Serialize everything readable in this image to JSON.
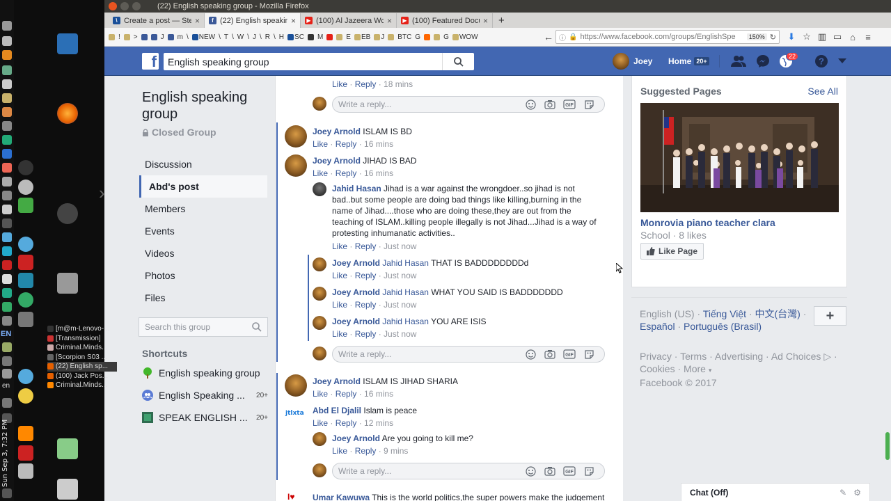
{
  "os": {
    "clock": "Sun Sep 3, 7:32 PM",
    "lang": "EN",
    "lang2": "en",
    "taskbar": [
      {
        "label": "[m@m-Lenovo-...",
        "color": "#333"
      },
      {
        "label": "[Transmission]",
        "color": "#c33"
      },
      {
        "label": "Criminal.Minds...",
        "color": "#caa"
      },
      {
        "label": "[Scorpion S03 ...",
        "color": "#666"
      },
      {
        "label": "(22) English sp...",
        "color": "#e66000"
      },
      {
        "label": "(100) Jack Pos...",
        "color": "#e66000"
      },
      {
        "label": "Criminal.Minds...",
        "color": "#f80"
      }
    ]
  },
  "browser": {
    "window_title": "(22) English speaking group - Mozilla Firefox",
    "tabs": [
      {
        "label": "Create a post — Steem",
        "icon": "steem-icon",
        "color": "#1a5099",
        "glyph": "\\"
      },
      {
        "label": "(22) English speaking",
        "icon": "facebook-icon",
        "color": "#3b5998",
        "glyph": "f",
        "active": true
      },
      {
        "label": "(100) Al Jazeera World",
        "icon": "youtube-icon",
        "color": "#e62117",
        "glyph": "▶"
      },
      {
        "label": "(100) Featured Docum",
        "icon": "youtube-icon",
        "color": "#e62117",
        "glyph": "▶"
      }
    ],
    "bookmarks": [
      {
        "label": "",
        "color": "#c9b26b"
      },
      {
        "label": "!",
        "color": ""
      },
      {
        "label": "",
        "color": "#c9b26b"
      },
      {
        "label": ">",
        "color": ""
      },
      {
        "label": "",
        "color": "#3b5998"
      },
      {
        "label": "",
        "color": "#3b5998"
      },
      {
        "label": "J",
        "color": ""
      },
      {
        "label": "",
        "color": "#3b5998"
      },
      {
        "label": "m",
        "color": ""
      },
      {
        "label": "\\",
        "color": ""
      },
      {
        "label": "NEW",
        "color": "#1a5099"
      },
      {
        "label": "\\",
        "color": ""
      },
      {
        "label": "T",
        "color": ""
      },
      {
        "label": "\\",
        "color": ""
      },
      {
        "label": "W",
        "color": ""
      },
      {
        "label": "\\",
        "color": ""
      },
      {
        "label": "J",
        "color": ""
      },
      {
        "label": "\\",
        "color": ""
      },
      {
        "label": "R",
        "color": ""
      },
      {
        "label": "\\",
        "color": ""
      },
      {
        "label": "H",
        "color": ""
      },
      {
        "label": "SC",
        "color": "#1a5099"
      },
      {
        "label": "",
        "color": "#333"
      },
      {
        "label": "M",
        "color": ""
      },
      {
        "label": "",
        "color": "#e62117"
      },
      {
        "label": "",
        "color": "#c9b26b"
      },
      {
        "label": "E",
        "color": ""
      },
      {
        "label": "EB",
        "color": "#c9b26b"
      },
      {
        "label": "J",
        "color": "#c9b26b"
      },
      {
        "label": "",
        "color": "#c9b26b"
      },
      {
        "label": "BTC",
        "color": ""
      },
      {
        "label": "G",
        "color": ""
      },
      {
        "label": "",
        "color": "#f60"
      },
      {
        "label": "",
        "color": "#c9b26b"
      },
      {
        "label": "G",
        "color": ""
      },
      {
        "label": "WOW",
        "color": "#c9b26b"
      }
    ],
    "url": "https://www.facebook.com/groups/EnglishSpe",
    "zoom": "150%"
  },
  "facebook": {
    "search_value": "English speaking group",
    "profile_name": "Joey",
    "home_label": "Home",
    "home_badge": "20+",
    "notif_count": "22"
  },
  "group": {
    "title": "English speaking group",
    "privacy": "Closed Group",
    "nav": [
      {
        "label": "Discussion",
        "active": false
      },
      {
        "label": "Abd's post",
        "active": true
      },
      {
        "label": "Members",
        "active": false
      },
      {
        "label": "Events",
        "active": false
      },
      {
        "label": "Videos",
        "active": false
      },
      {
        "label": "Photos",
        "active": false
      },
      {
        "label": "Files",
        "active": false
      }
    ],
    "search_placeholder": "Search this group",
    "shortcuts_title": "Shortcuts",
    "shortcuts": [
      {
        "label": "English speaking group",
        "badge": "",
        "icon": "tree-icon"
      },
      {
        "label": "English Speaking ...",
        "badge": "20+",
        "icon": "group-icon"
      },
      {
        "label": "SPEAK ENGLISH ...",
        "badge": "20+",
        "icon": "page-icon"
      }
    ]
  },
  "feed": {
    "top_actions": {
      "like": "Like",
      "reply": "Reply",
      "time": "18 mins"
    },
    "reply_placeholder": "Write a reply...",
    "comments": [
      {
        "id": "c1",
        "author": "Joey Arnold",
        "text": "ISLAM IS BD",
        "time": "16 mins"
      },
      {
        "id": "c2",
        "author": "Joey Arnold",
        "text": "JIHAD IS BAD",
        "time": "16 mins"
      },
      {
        "id": "c3",
        "author": "Jahid Hasan",
        "lines": [
          "Jihad is a war against the wrongdoer..so jihad is not",
          "bad..but some people are doing bad things like killing,burning in the",
          "name of Jihad....those who are doing these,they are out from the",
          "teaching of ISLAM..killing people illegally is not Jihad...Jihad is a way of",
          "protesting inhumanatic activities.."
        ],
        "time": "Just now"
      },
      {
        "id": "c4",
        "author": "Joey Arnold",
        "tag": "Jahid Hasan",
        "text": "THAT IS BADDDDDDDDd",
        "time": "Just now"
      },
      {
        "id": "c5",
        "author": "Joey Arnold",
        "tag": "Jahid Hasan",
        "text": "WHAT YOU SAID IS BADDDDDDD",
        "time": "Just now"
      },
      {
        "id": "c6",
        "author": "Joey Arnold",
        "tag": "Jahid Hasan",
        "text": "YOU ARE ISIS",
        "time": "Just now"
      },
      {
        "id": "c7",
        "author": "Joey Arnold",
        "text": "ISLAM IS JIHAD SHARIA",
        "time": "16 mins"
      },
      {
        "id": "c8",
        "author": "Abd El Djalil",
        "text": "Islam is peace",
        "time": "12 mins"
      },
      {
        "id": "c9",
        "author": "Joey Arnold",
        "text": "Are you going to kill me?",
        "time": "9 mins"
      },
      {
        "id": "c10",
        "author": "Umar Kawuwa",
        "text": "This is the world politics,the super powers make the judgement"
      }
    ],
    "like_label": "Like",
    "reply_label": "Reply",
    "abd_avatar_text": "jtlxta"
  },
  "right": {
    "suggested_title": "Suggested Pages",
    "see_all": "See All",
    "page_name": "Monrovia piano teacher clara",
    "page_meta": "School · 8 likes",
    "like_page": "Like Page",
    "languages": {
      "current": "English (US)",
      "others": [
        "Tiếng Việt",
        "中文(台灣)",
        "Español",
        "Português (Brasil)"
      ]
    },
    "footer": {
      "links": [
        "Privacy",
        "Terms",
        "Advertising",
        "Ad Choices",
        "Cookies",
        "More"
      ],
      "copyright": "Facebook © 2017"
    }
  },
  "chat": {
    "label": "Chat (Off)"
  }
}
